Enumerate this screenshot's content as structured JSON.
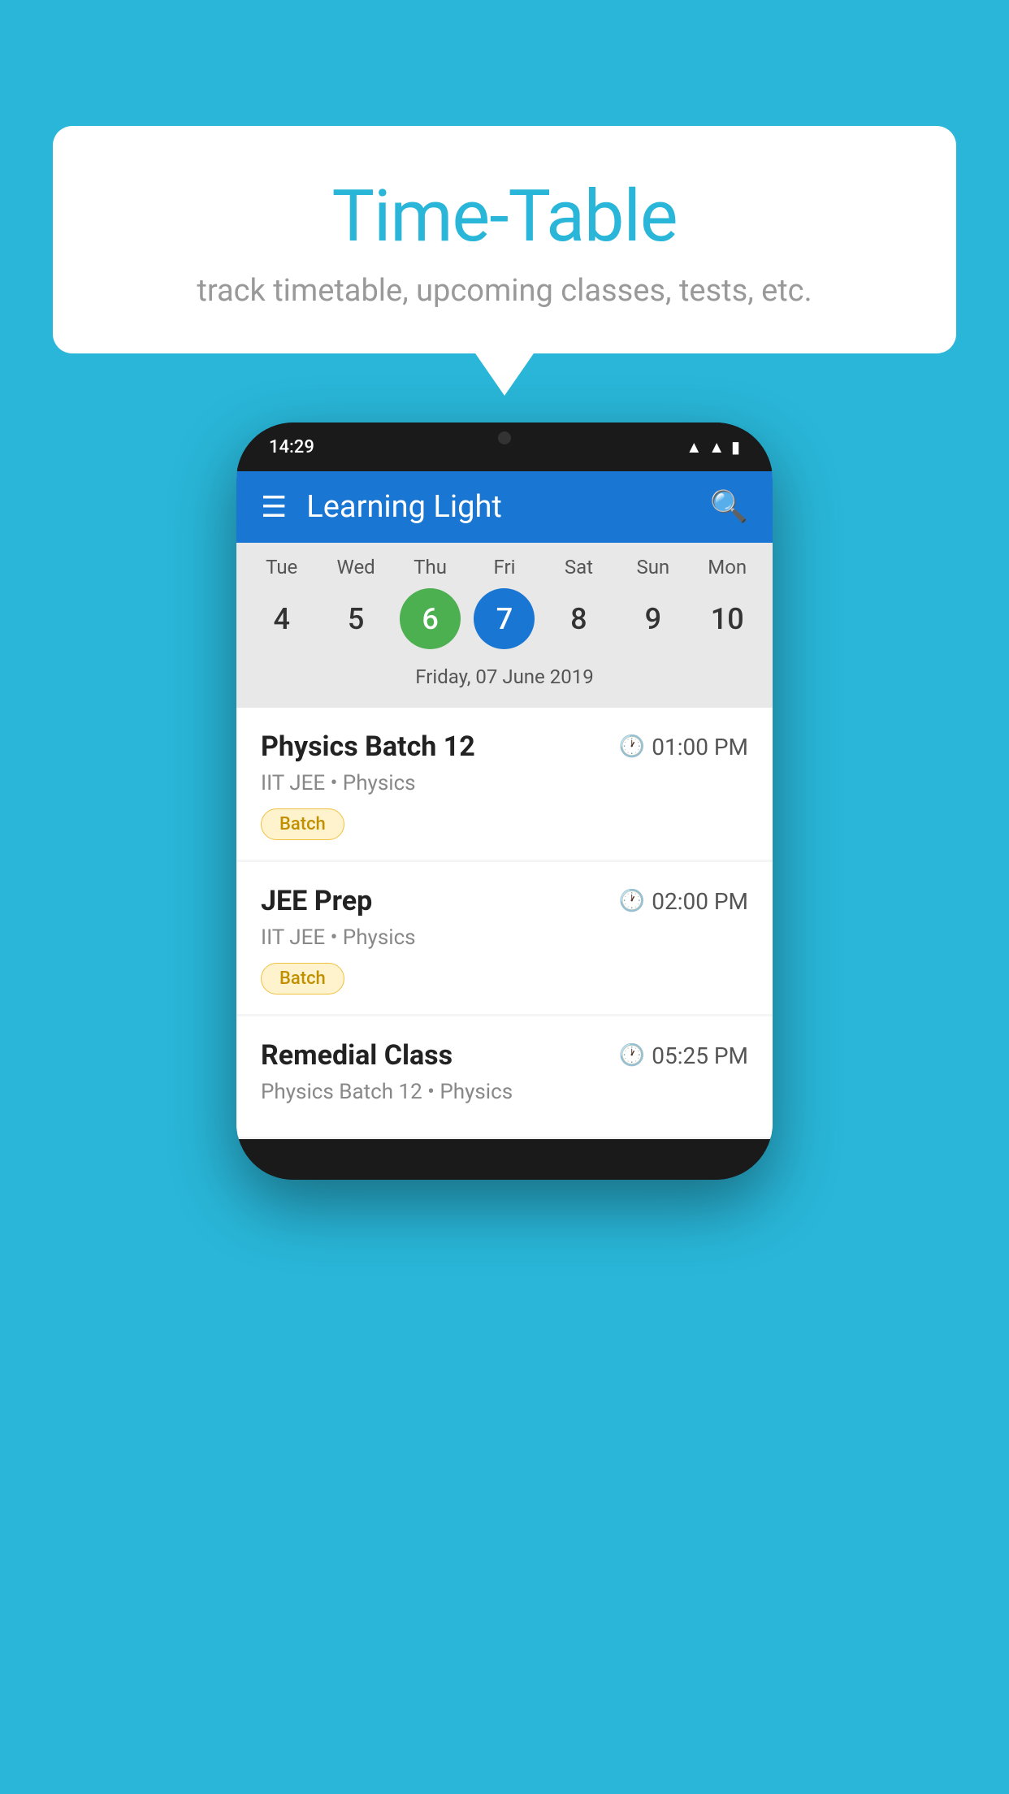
{
  "background_color": "#29b6d8",
  "bubble": {
    "title": "Time-Table",
    "subtitle": "track timetable, upcoming classes, tests, etc."
  },
  "phone": {
    "status_bar": {
      "time": "14:29"
    },
    "app_bar": {
      "title": "Learning Light"
    },
    "calendar": {
      "days": [
        {
          "label": "Tue",
          "number": "4"
        },
        {
          "label": "Wed",
          "number": "5"
        },
        {
          "label": "Thu",
          "number": "6",
          "state": "today"
        },
        {
          "label": "Fri",
          "number": "7",
          "state": "selected"
        },
        {
          "label": "Sat",
          "number": "8"
        },
        {
          "label": "Sun",
          "number": "9"
        },
        {
          "label": "Mon",
          "number": "10"
        }
      ],
      "selected_date": "Friday, 07 June 2019"
    },
    "schedule": [
      {
        "title": "Physics Batch 12",
        "time": "01:00 PM",
        "subtitle": "IIT JEE • Physics",
        "tag": "Batch"
      },
      {
        "title": "JEE Prep",
        "time": "02:00 PM",
        "subtitle": "IIT JEE • Physics",
        "tag": "Batch"
      },
      {
        "title": "Remedial Class",
        "time": "05:25 PM",
        "subtitle": "Physics Batch 12 • Physics",
        "tag": null
      }
    ]
  }
}
